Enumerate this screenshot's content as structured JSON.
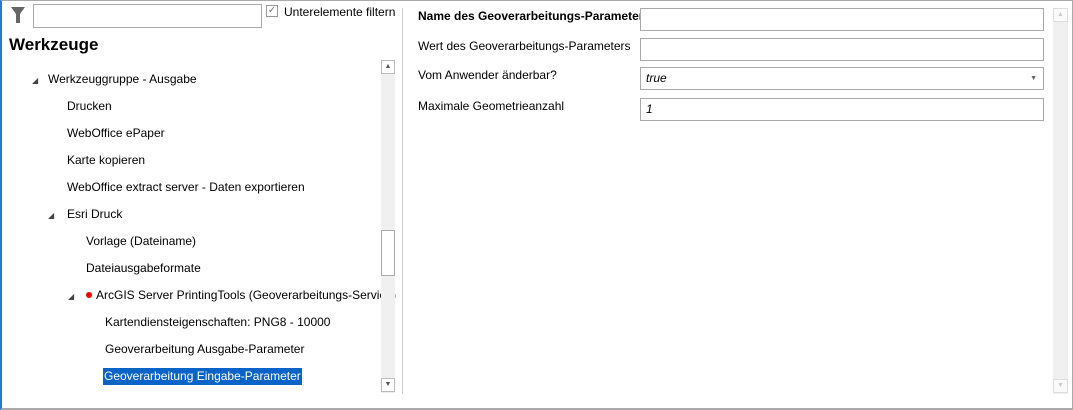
{
  "filter": {
    "search_value": "",
    "subfilter_label": "Unterelemente filtern",
    "subfilter_checked": true
  },
  "tree": {
    "title": "Werkzeuge",
    "items": [
      {
        "label": "Werkzeuggruppe - Ausgabe"
      },
      {
        "label": "Drucken"
      },
      {
        "label": "WebOffice ePaper"
      },
      {
        "label": "Karte kopieren"
      },
      {
        "label": "WebOffice extract server - Daten exportieren"
      },
      {
        "label": "Esri Druck"
      },
      {
        "label": "Vorlage (Dateiname)"
      },
      {
        "label": "Dateiausgabeformate"
      },
      {
        "label": "ArcGIS Server PrintingTools (Geoverarbeitungs-Service)"
      },
      {
        "label": "Kartendiensteigenschaften: PNG8 - 10000"
      },
      {
        "label": "Geoverarbeitung Ausgabe-Parameter"
      },
      {
        "label": "Geoverarbeitung Eingabe-Parameter"
      }
    ]
  },
  "props": {
    "name_label": "Name des Geoverarbeitungs-Parameters",
    "name_value": "",
    "value_label": "Wert des Geoverarbeitungs-Parameters",
    "value_value": "",
    "editable_label": "Vom Anwender änderbar?",
    "editable_value": "true",
    "maxgeom_label": "Maximale Geometrieanzahl",
    "maxgeom_value": "1"
  }
}
